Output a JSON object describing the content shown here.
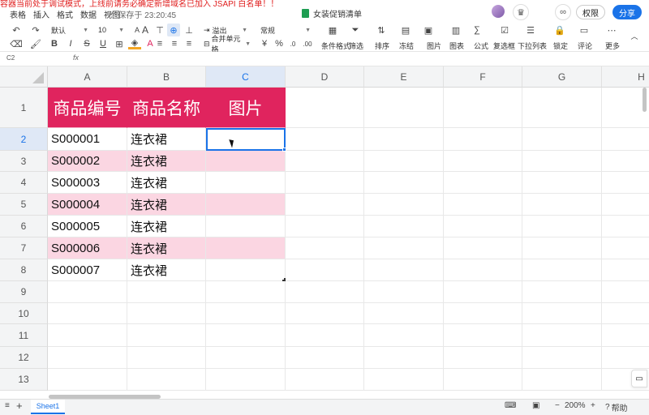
{
  "warning": "容器当前处于调试模式，上线前请务必确定新增域名已加入 JSAPI 白名单！！",
  "menu": [
    "表格",
    "插入",
    "格式",
    "数据",
    "视图"
  ],
  "save_status": "保存于 23:20:45",
  "doc_title": "女装促销清单",
  "buttons": {
    "permission": "权限",
    "share": "分享"
  },
  "toolbar": {
    "font": "默认",
    "size": "10",
    "overflow": "溢出",
    "merge": "合并单元格",
    "number_format": "常规",
    "percent": "%",
    "decimal_more": ".0",
    "decimal_less": ".00",
    "labels": {
      "cond_format": "条件格式",
      "filter": "筛选",
      "sort": "排序",
      "freeze": "冻结",
      "image": "图片",
      "chart": "图表",
      "formula": "公式",
      "checkbox": "复选框",
      "dropdown": "下拉列表",
      "lock": "锁定",
      "comment": "评论",
      "more": "更多"
    }
  },
  "name_box": "C2",
  "fx": "fx",
  "columns": [
    "A",
    "B",
    "C",
    "D",
    "E",
    "F",
    "G",
    "H"
  ],
  "rows": [
    "1",
    "2",
    "3",
    "4",
    "5",
    "6",
    "7",
    "8",
    "9",
    "10",
    "11",
    "12",
    "13"
  ],
  "header_row": [
    "商品编号",
    "商品名称",
    "图片"
  ],
  "data_rows": [
    [
      "S000001",
      "连衣裙"
    ],
    [
      "S000002",
      "连衣裙"
    ],
    [
      "S000003",
      "连衣裙"
    ],
    [
      "S000004",
      "连衣裙"
    ],
    [
      "S000005",
      "连衣裙"
    ],
    [
      "S000006",
      "连衣裙"
    ],
    [
      "S000007",
      "连衣裙"
    ]
  ],
  "sheet_tab": "Sheet1",
  "zoom": "200%",
  "help": "帮助",
  "colors": {
    "header_bg": "#e0245e",
    "band_bg": "#fbd6e2",
    "accent": "#1a73e8"
  }
}
